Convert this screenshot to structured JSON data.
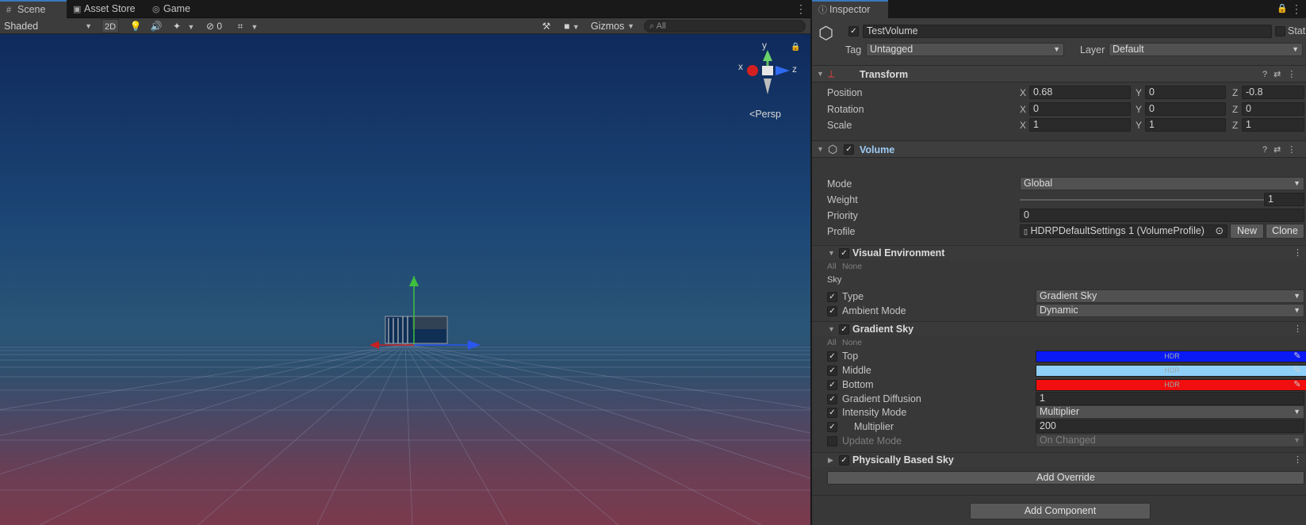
{
  "scene_tabs": [
    {
      "label": "Scene",
      "icon": "grid-icon"
    },
    {
      "label": "Asset Store",
      "icon": "bag-icon"
    },
    {
      "label": "Game",
      "icon": "gamepad-icon"
    }
  ],
  "scene_toolbar": {
    "shading_mode": "Shaded",
    "mode_2d": "2D",
    "hidden_count": "0",
    "gizmos": "Gizmos",
    "search_placeholder": "All"
  },
  "gizmo": {
    "x": "x",
    "y": "y",
    "z": "z",
    "persp": "Persp"
  },
  "inspector": {
    "tab": "Inspector",
    "object_name": "TestVolume",
    "static_label": "Static",
    "tag_label": "Tag",
    "tag_value": "Untagged",
    "layer_label": "Layer",
    "layer_value": "Default"
  },
  "transform": {
    "title": "Transform",
    "rows": [
      {
        "label": "Position",
        "x": "0.68",
        "y": "0",
        "z": "-0.8"
      },
      {
        "label": "Rotation",
        "x": "0",
        "y": "0",
        "z": "0"
      },
      {
        "label": "Scale",
        "x": "1",
        "y": "1",
        "z": "1"
      }
    ],
    "axis": {
      "x": "X",
      "y": "Y",
      "z": "Z"
    }
  },
  "volume": {
    "title": "Volume",
    "mode_label": "Mode",
    "mode_value": "Global",
    "weight_label": "Weight",
    "weight_value": "1",
    "weight_level": 1,
    "priority_label": "Priority",
    "priority_value": "0",
    "profile_label": "Profile",
    "profile_value": "HDRPDefaultSettings 1 (VolumeProfile)",
    "new_label": "New",
    "clone_label": "Clone"
  },
  "visual_env": {
    "title": "Visual Environment",
    "all": "All",
    "none": "None",
    "section": "Sky",
    "type_label": "Type",
    "type_value": "Gradient Sky",
    "ambient_label": "Ambient Mode",
    "ambient_value": "Dynamic"
  },
  "gradient_sky": {
    "title": "Gradient Sky",
    "all": "All",
    "none": "None",
    "top_label": "Top",
    "top_color": "#0a1af5",
    "middle_label": "Middle",
    "middle_color": "#8fd0f8",
    "bottom_label": "Bottom",
    "bottom_color": "#f00e0e",
    "hdr": "HDR",
    "diffusion_label": "Gradient Diffusion",
    "diffusion_value": "1",
    "intensity_label": "Intensity Mode",
    "intensity_value": "Multiplier",
    "multiplier_label": "Multiplier",
    "multiplier_value": "200",
    "update_label": "Update Mode",
    "update_value": "On Changed"
  },
  "physically_based_sky": {
    "title": "Physically Based Sky"
  },
  "buttons": {
    "add_override": "Add Override",
    "add_component": "Add Component"
  }
}
